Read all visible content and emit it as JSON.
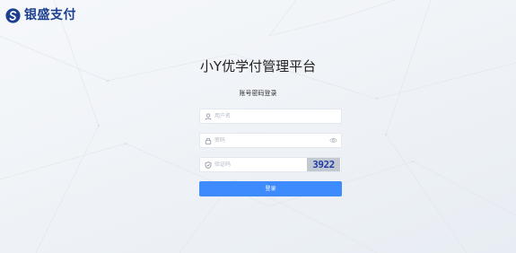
{
  "brand": {
    "logo_text": "银盛支付",
    "logo_icon": "yinsheng-logo-icon",
    "color": "#1c3f8f"
  },
  "page": {
    "title": "小Y优学付管理平台",
    "subtitle": "账号密码登录"
  },
  "form": {
    "username": {
      "placeholder": "用户名",
      "value": "",
      "icon": "user-icon"
    },
    "password": {
      "placeholder": "密码",
      "value": "",
      "icon": "lock-icon",
      "toggle_icon": "eye-icon"
    },
    "captcha": {
      "placeholder": "验证码",
      "value": "",
      "icon": "shield-icon",
      "image_text": "3922"
    },
    "submit_label": "登录"
  },
  "colors": {
    "primary": "#3d8bfd",
    "background": "#eef2f6",
    "field_icon": "#7a8494"
  }
}
